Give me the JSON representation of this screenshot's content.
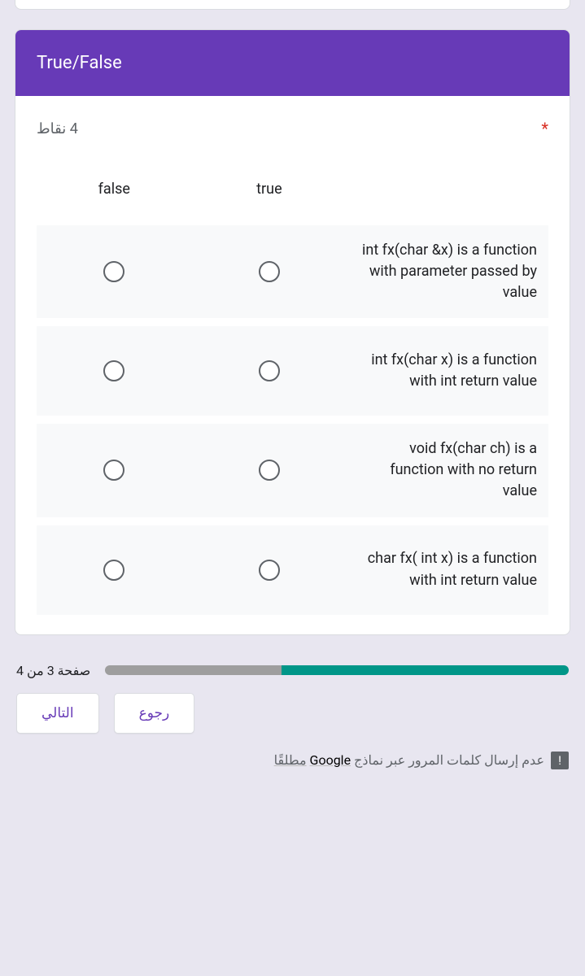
{
  "section": {
    "title": "True/False"
  },
  "question": {
    "required_mark": "*",
    "points": "4 نقاط",
    "columns": {
      "false": "false",
      "true": "true"
    },
    "rows": [
      {
        "label": "int fx(char &x) is a function with parameter passed by value"
      },
      {
        "label": "int fx(char x) is a function with int return value"
      },
      {
        "label": "void fx(char ch) is a function with no return value"
      },
      {
        "label": "char fx( int x) is a function with int return value"
      }
    ]
  },
  "footer": {
    "page_indicator": "صفحة 3 من 4",
    "buttons": {
      "next": "التالي",
      "back": "رجوع"
    },
    "notice_pre": "عدم إرسال كلمات المرور عبر نماذج",
    "notice_google": "Google",
    "notice_post": "مطلقًا"
  }
}
